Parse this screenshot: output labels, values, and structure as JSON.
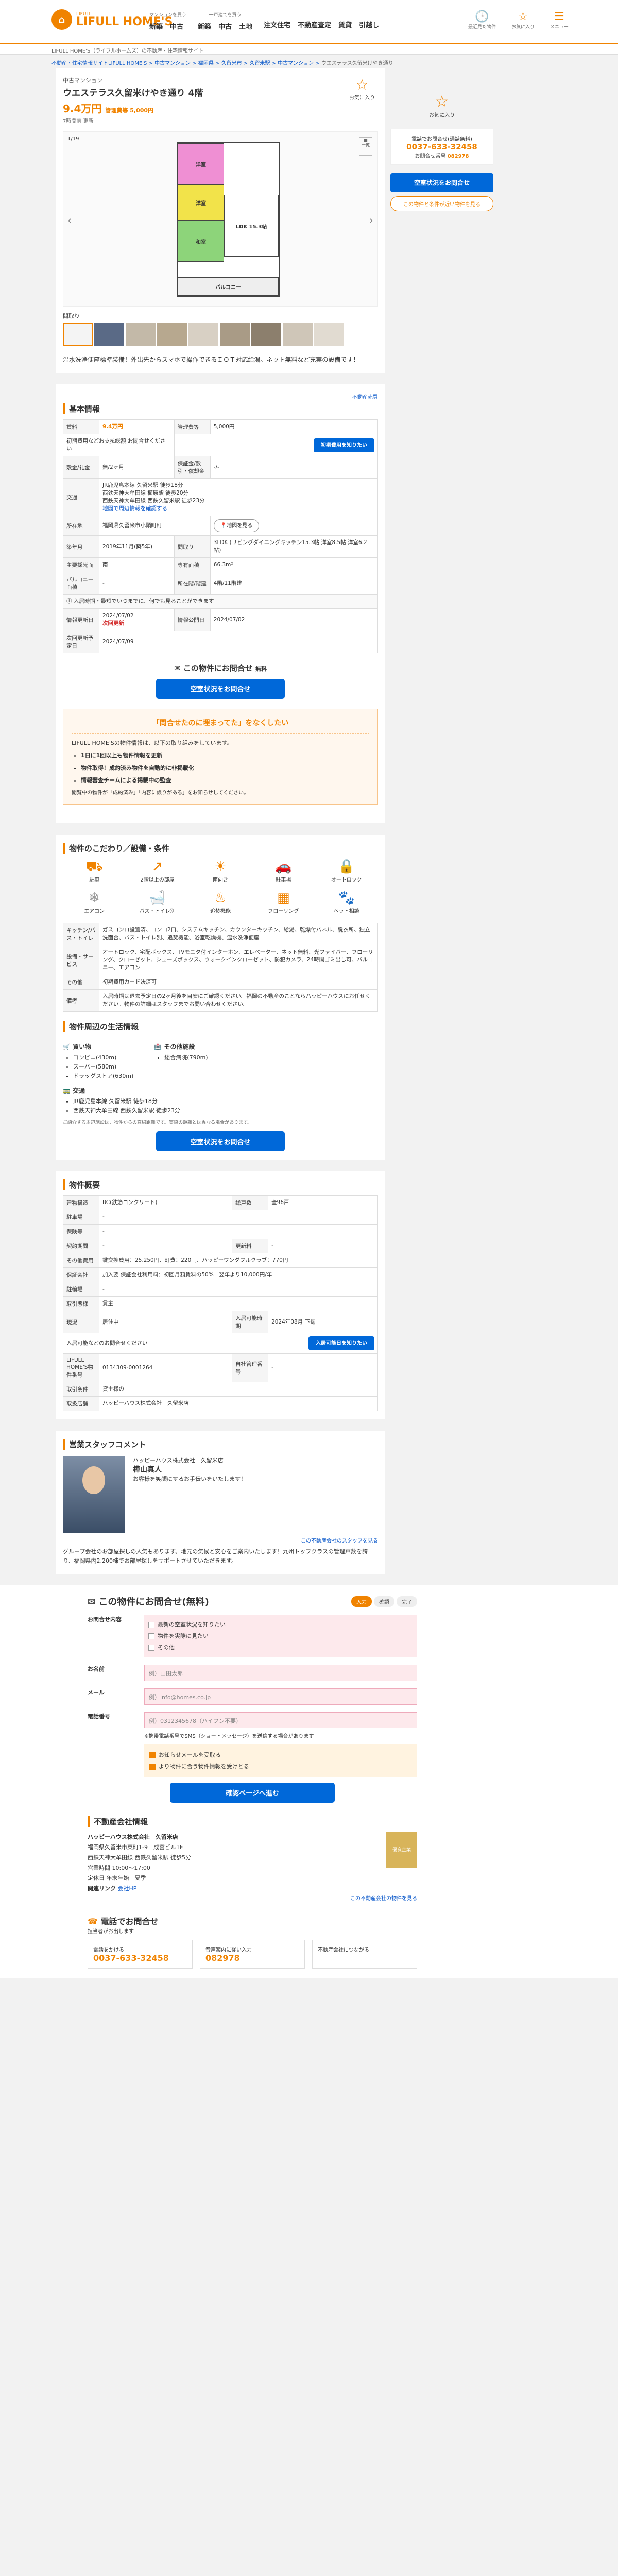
{
  "header": {
    "logo_name": "LIFULL HOME'S",
    "logo_sub": "LIFULL",
    "nav": [
      {
        "cap": "マンションを買う",
        "items": [
          "新築",
          "中古"
        ]
      },
      {
        "cap": "一戸建てを買う",
        "items": [
          "新築",
          "中古",
          "土地"
        ]
      },
      {
        "cap": "",
        "items": [
          "注文住宅",
          "不動産査定",
          "賃貸",
          "引越し"
        ]
      }
    ],
    "icons": [
      "最近見た物件",
      "お気に入り",
      "メニュー"
    ],
    "subline": "LIFULL HOME'S（ライフルホームズ）の不動産・住宅情報サイト"
  },
  "breadcrumb": [
    "不動産・住宅情報サイトLIFULL HOME'S",
    "中古マンション",
    "福岡県",
    "久留米市",
    "久留米駅",
    "中古マンション",
    "ウエステラス久留米けやき通り"
  ],
  "property": {
    "type": "中古マンション",
    "title": "ウエステラス久留米けやき通り 4階",
    "price": "9.4万円",
    "price_sub": "管理費等 5,000円",
    "updated": "7時間前 更新",
    "favorite": "お気に入り",
    "gallery_count": "1/19",
    "gallery_list": "一覧",
    "thumbs_label": "間取り",
    "comment": "温水洗浄便座標準装備！外出先からスマホで操作できるＩＯＴ対応給湯。ネット無料など充実の設備です！"
  },
  "floorplan": {
    "rooms": [
      "洋室",
      "洋室",
      "LDK 15.3帖",
      "和室",
      "バルコニー"
    ]
  },
  "side": {
    "favorite": "お気に入り",
    "tel_caption": "電話でお問合せ(通話無料)",
    "tel": "0037-633-32458",
    "code_label": "お問合せ番号",
    "code": "082978",
    "contact_btn": "空室状況をお問合せ",
    "other_link": "この物件と条件が近い物件を見る"
  },
  "basic": {
    "title": "基本情報",
    "toplink": "不動産売買",
    "rows": [
      {
        "k": "賃料",
        "v": "9.4万円",
        "k2": "管理費等",
        "v2": "5,000円"
      },
      {
        "k": "初期費用などお支払総額",
        "v": "お問合せください",
        "btn": "初期費用を知りたい"
      },
      {
        "k": "敷金/礼金",
        "v": "無/2ヶ月",
        "k2": "保証金/敷引・償却金",
        "v2": "-/-"
      },
      {
        "k": "交通",
        "v": "JR鹿児島本線 久留米駅 徒歩18分\n西鉄天神大牟田線 櫛原駅 徒歩20分\n西鉄天神大牟田線 西鉄久留米駅 徒歩23分",
        "link": "地図で周辺情報を確認する"
      },
      {
        "k": "所在地",
        "v": "福岡県久留米市小頭町町",
        "btn": "地図を見る"
      },
      {
        "k": "築年月",
        "v": "2019年11月(築5年)",
        "k2": "間取り",
        "v2": "3LDK (リビングダイニングキッチン15.3帖 洋室8.5帖 洋室6.2帖)"
      },
      {
        "k": "主要採光面",
        "v": "南",
        "k2": "専有面積",
        "v2": "66.3m²"
      },
      {
        "k": "バルコニー面積",
        "v": "-",
        "k2": "所在階/階建",
        "v2": "4階/11階建"
      },
      {
        "k": "情報更新日",
        "v": "2024/07/02",
        "note": "次回更新",
        "k2": "情報公開日",
        "v2": "2024/07/02"
      },
      {
        "k": "次回更新予定日",
        "v": "2024/07/09"
      }
    ],
    "notice": "入居時期・最短でいつまでに、何でも見ることができます",
    "cta_title": "この物件にお問合せ",
    "cta_free": "無料",
    "cta_btn": "空室状況をお問合せ"
  },
  "banner": {
    "title": "「問合せたのに埋まってた」をなくしたい",
    "lead": "LIFULL HOME'Sの物件情報は、以下の取り組みをしています。",
    "items": [
      "1日に1回以上も物件情報を更新",
      "物件取得！成約済み物件を自動的に非掲載化",
      "情報審査チームによる掲載中の監査"
    ],
    "foot": "閲覧中の物件が「成約済み」「内容に誤りがある」をお知らせしてください。"
  },
  "features": {
    "title": "物件のこだわり／設備・条件",
    "icons": [
      {
        "label": "駐車",
        "on": true,
        "sym": "⛟"
      },
      {
        "label": "2階以上の部屋",
        "on": true,
        "sym": "↗"
      },
      {
        "label": "南向き",
        "on": true,
        "sym": "☀"
      },
      {
        "label": "駐車場",
        "on": true,
        "sym": "🚗"
      },
      {
        "label": "オートロック",
        "on": true,
        "sym": "🔒"
      },
      {
        "label": "エアコン",
        "on": false,
        "sym": "❄"
      },
      {
        "label": "バス・トイレ別",
        "on": true,
        "sym": "🛁"
      },
      {
        "label": "追焚機能",
        "on": true,
        "sym": "♨"
      },
      {
        "label": "フローリング",
        "on": true,
        "sym": "▦"
      },
      {
        "label": "ペット相談",
        "on": false,
        "sym": "🐾"
      }
    ],
    "rows": [
      {
        "k": "キッチン/バス・トイレ",
        "v": "ガスコンロ設置済、コンロ2口、システムキッチン、カウンターキッチン、給湯、乾燥付パネル、脱衣所、独立洗面台、バス・トイレ別、追焚機能、浴室乾燥機、温水洗浄便座"
      },
      {
        "k": "設備・サービス",
        "v": "オートロック、宅配ボックス、TVモニタ付インターホン、エレベーター、ネット無料、光ファイバー、フローリング、クローゼット、シューズボックス、ウォークインクローゼット、防犯カメラ、24時間ゴミ出し可、バルコニー、エアコン"
      },
      {
        "k": "その他",
        "v": "初期費用カード決済可"
      },
      {
        "k": "備考",
        "v": "入居時期は退去予定日の2ヶ月後を目安にご確認ください。福岡の不動産のことならハッピーハウスにお任せください。物件の詳細はスタッフまでお問い合わせください。"
      }
    ]
  },
  "life": {
    "title": "物件周辺の生活情報",
    "shop_title": "買い物",
    "shop": [
      "コンビニ(430m)",
      "スーパー(580m)",
      "ドラッグストア(630m)"
    ],
    "other_title": "その他施設",
    "other": [
      "総合病院(790m)"
    ],
    "traffic_title": "交通",
    "traffic": [
      "JR鹿児島本線 久留米駅 徒歩18分",
      "西鉄天神大牟田線 西鉄久留米駅 徒歩23分"
    ],
    "note": "ご紹介する周辺施設は、物件からの直線距離です。実際の距離とは異なる場合があります。",
    "cta_btn": "空室状況をお問合せ"
  },
  "outline": {
    "title": "物件概要",
    "rows": [
      {
        "k": "建物構造",
        "v": "RC(鉄筋コンクリート)",
        "k2": "総戸数",
        "v2": "全96戸"
      },
      {
        "k": "駐車場",
        "v": "-",
        "k2": "",
        "v2": ""
      },
      {
        "k": "保険等",
        "v": "-",
        "k2": "",
        "v2": ""
      },
      {
        "k": "契約期間",
        "v": "-",
        "k2": "更新料",
        "v2": "-"
      },
      {
        "k": "その他費用",
        "v": "鍵交換費用：25,250円、町費：220円、ハッピーワンダフルクラブ：770円"
      },
      {
        "k": "保証会社",
        "v": "加入要 保証会社利用料：初回月額賃料の50%　翌年より10,000円/年"
      },
      {
        "k": "駐輪場",
        "v": "-"
      },
      {
        "k": "取引態様",
        "v": "貸主"
      },
      {
        "k": "現況",
        "v": "居住中",
        "k2": "入居可能時期",
        "v2": "2024年08月 下旬"
      },
      {
        "k": "入居可能などのお問合せください",
        "v": "",
        "btn": "入居可能日を知りたい"
      },
      {
        "k": "LIFULL HOME'S物件番号",
        "v": "0134309-0001264",
        "k2": "自社管理番号",
        "v2": "-"
      },
      {
        "k": "取引条件",
        "v": "貸主様の"
      },
      {
        "k": "取扱店舗",
        "v": "ハッピーハウス株式会社　久留米店"
      }
    ]
  },
  "staff": {
    "title": "営業スタッフコメント",
    "company": "ハッピーハウス株式会社　久留米店",
    "name": "樺山真人",
    "greet": "お客様を笑顔にするお手伝いをいたします！",
    "comment": "グループ会社のお部屋探しの人気もあります。地元の気候と安心をご案内いたします！九州トップクラスの管理戸数を誇り、福岡県内2,200棟でお部屋探しをサポートさせていただきます。",
    "link": "この不動産会社のスタッフを見る"
  },
  "form": {
    "title": "この物件にお問合せ(無料)",
    "steps": [
      "入力",
      "確認",
      "完了"
    ],
    "q_label": "お問合せ内容",
    "options": [
      "最新の空室状況を知りたい",
      "物件を実際に見たい",
      "その他"
    ],
    "name_label": "お名前",
    "name_ph": "例）山田太郎",
    "mail_label": "メール",
    "mail_ph": "例）info@homes.co.jp",
    "tel_label": "電話番号",
    "tel_ph": "例）0312345678（ハイフン不要）",
    "sms": "※携帯電話番号でSMS（ショートメッセージ）を送信する場合があります",
    "opt1": "お知らせメールを受取る",
    "opt2": "より物件に合う物件情報を受けとる",
    "submit": "確認ページへ進む"
  },
  "agency": {
    "title": "不動産会社情報",
    "name": "ハッピーハウス株式会社　久留米店",
    "addr": "福岡県久留米市東町1-9　成富ビル1F",
    "station": "西鉄天神大牟田線 西鉄久留米駅 徒歩5分",
    "hours": "営業時間 10:00～17:00",
    "holiday": "定休日 年末年始　夏季",
    "link_label": "関連リンク",
    "link": "会社HP",
    "badge": "優良企業",
    "link2": "この不動産会社の物件を見る"
  },
  "tel": {
    "title": "電話でお問合せ",
    "sub": "担当者がお出します",
    "step1": "電話をかける",
    "step1_tel": "0037-633-32458",
    "step2": "音声案内に従い入力",
    "step2_code": "082978",
    "step3": "不動産会社につながる"
  }
}
